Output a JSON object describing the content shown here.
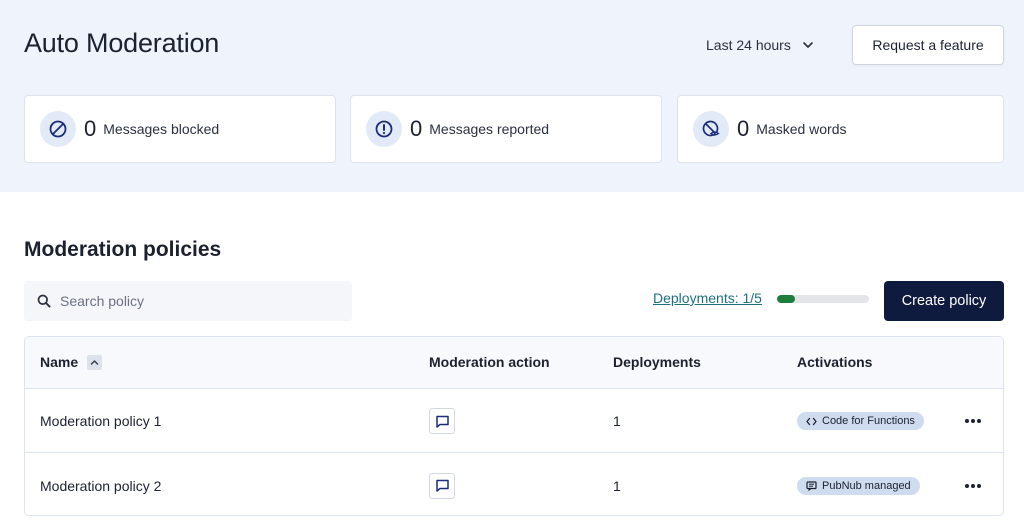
{
  "header": {
    "title": "Auto Moderation",
    "timeframe": "Last 24 hours",
    "request_label": "Request a feature"
  },
  "stats": [
    {
      "icon": "blocked-icon",
      "value": "0",
      "label": "Messages blocked"
    },
    {
      "icon": "alert-icon",
      "value": "0",
      "label": "Messages reported"
    },
    {
      "icon": "eye-masked-icon",
      "value": "0",
      "label": "Masked words"
    }
  ],
  "policies": {
    "title": "Moderation policies",
    "search_placeholder": "Search policy",
    "deployments_label": "Deployments: 1/5",
    "deployments_progress": 0.2,
    "create_label": "Create policy",
    "columns": [
      "Name",
      "Moderation action",
      "Deployments",
      "Activations"
    ],
    "rows": [
      {
        "name": "Moderation policy 1",
        "action_icon": "chat-icon",
        "deployments": "1",
        "activation": "Code for Functions",
        "activation_icon": "code-icon"
      },
      {
        "name": "Moderation policy 2",
        "action_icon": "chat-icon",
        "deployments": "1",
        "activation": "PubNub managed",
        "activation_icon": "message-icon"
      }
    ]
  },
  "colors": {
    "hero_bg": "#eef3fc",
    "primary_button": "#0f1a3f",
    "link": "#1e7080",
    "progress": "#1d7d3d",
    "icon": "#1b2d78",
    "badge_bg": "#cfdcef"
  }
}
